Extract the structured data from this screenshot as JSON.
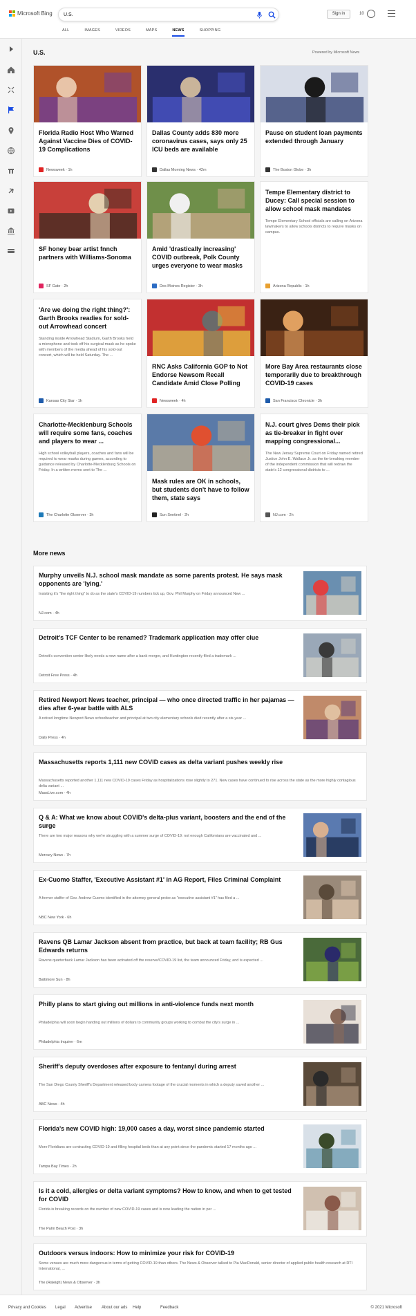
{
  "header": {
    "logo_text": "Microsoft Bing",
    "search_value": "U.S.",
    "nav": [
      "ALL",
      "IMAGES",
      "VIDEOS",
      "MAPS",
      "NEWS",
      "SHOPPING"
    ],
    "active_nav": "NEWS",
    "signin": "Sign in",
    "rewards_count": "10",
    "accent": "#174ae4"
  },
  "section": {
    "title": "U.S.",
    "powered_by": "Powered by Microsoft News",
    "more_title": "More news"
  },
  "cards": [
    {
      "title": "Florida Radio Host Who Warned Against Vaccine Dies of COVID-19 Complications",
      "desc": "",
      "source": "Newsweek",
      "time": "1h",
      "icon": "#e02424"
    },
    {
      "title": "Dallas County adds 830 more coronavirus cases, says only 25 ICU beds are available",
      "desc": "",
      "source": "Dallas Morning News",
      "time": "42m",
      "icon": "#333333"
    },
    {
      "title": "Pause on student loan payments extended through January",
      "desc": "",
      "source": "The Boston Globe",
      "time": "3h",
      "icon": "#333333"
    },
    {
      "title": "SF honey bear artist fnnch partners with Williams-Sonoma",
      "desc": "",
      "source": "SF Gate",
      "time": "2h",
      "icon": "#e0245e"
    },
    {
      "title": "Amid 'drastically increasing' COVID outbreak, Polk County urges everyone to wear masks",
      "desc": "",
      "source": "Des Moines Register",
      "time": "3h",
      "icon": "#2b6cc4"
    },
    {
      "title": "Tempe Elementary district to Ducey: Call special session to allow school mask mandates",
      "desc": "Tempe Elementary School officials are calling on Arizona lawmakers to allow schools districts to require masks on campus.",
      "source": "Arizona Republic",
      "time": "1h",
      "icon": "#e8a030"
    },
    {
      "title": "'Are we doing the right thing?': Garth Brooks readies for sold-out Arrowhead concert",
      "desc": "Standing inside Arrowhead Stadium, Garth Brooks held a microphone and took off his surgical mask as he spoke with members of the media ahead of his sold-out concert, which will be held Saturday. The ...",
      "source": "Kansas City Star",
      "time": "1h",
      "icon": "#1e5bab"
    },
    {
      "title": "RNC Asks California GOP to Not Endorse Newsom Recall Candidate Amid Close Polling",
      "desc": "",
      "source": "Newsweek",
      "time": "4h",
      "icon": "#e02424"
    },
    {
      "title": "More Bay Area restaurants close temporarily due to breakthrough COVID-19 cases",
      "desc": "",
      "source": "San Francisco Chronicle",
      "time": "3h",
      "icon": "#1e5bab"
    },
    {
      "title": "Charlotte-Mecklenburg Schools will require some fans, coaches and players to wear ...",
      "desc": "High school volleyball players, coaches and fans will be required to wear masks during games, according to guidance released by Charlotte-Mecklenburg Schools on Friday. In a written memo sent to The ...",
      "source": "The Charlotte Observer",
      "time": "3h",
      "icon": "#1e7ab8"
    },
    {
      "title": "Mask rules are OK in schools, but students don't have to follow them, state says",
      "desc": "",
      "source": "Sun Sentinel",
      "time": "2h",
      "icon": "#222222"
    },
    {
      "title": "N.J. court gives Dems their pick as tie-breaker in fight over mapping congressional...",
      "desc": "The New Jersey Supreme Court on Friday named retired Justice John E. Wallace Jr. as the tie-breaking member of the independent commission that will redraw the state's 12 congressional districts to ...",
      "source": "NJ.com",
      "time": "2h",
      "icon": "#555555"
    }
  ],
  "more": [
    {
      "title": "Murphy unveils N.J. school mask mandate as some parents protest. He says mask opponents are 'lying.'",
      "desc": "Insisting it's \"the right thing\" to do as the state's COVID-19 numbers tick up, Gov. Phil Murphy on Friday announced New ...",
      "source": "NJ.com",
      "time": "4h",
      "icon": "#555555"
    },
    {
      "title": "Detroit's TCF Center to be renamed? Trademark application may offer clue",
      "desc": "Detroit's convention center likely needs a new name after a bank merger, and Huntington recently filed a trademark ...",
      "source": "Detroit Free Press",
      "time": "4h",
      "icon": "#1e5bab"
    },
    {
      "title": "Retired Newport News teacher, principal — who once directed traffic in her pajamas — dies after 6-year battle with ALS",
      "desc": "A retired longtime Newport News schoolteacher and principal at two city elementary schools died recently after a six-year ...",
      "source": "Daily Press",
      "time": "4h",
      "icon": "#333333"
    },
    {
      "title": "Massachusetts reports 1,111 new COVID cases as delta variant pushes weekly rise",
      "desc": "Massachusetts reported another 1,111 new COVID-19 cases Friday as hospitalizations rose slightly to 271. New cases have continued to rise across the state as the more highly contagious delta variant ...",
      "source": "MassLive.com",
      "time": "4h",
      "icon": "#e02424"
    },
    {
      "title": "Q & A: What we know about COVID's delta-plus variant, boosters and the end of the surge",
      "desc": "There are two major reasons why we're struggling with a summer surge of COVID-19: not enough Californians are vaccinated and ...",
      "source": "Mercury News",
      "time": "7h",
      "icon": "#1e5bab"
    },
    {
      "title": "Ex-Cuomo Staffer, 'Executive Assistant #1' in AG Report, Files Criminal Complaint",
      "desc": "A former staffer of Gov. Andrew Cuomo identified in the attorney general probe as \"executive assistant #1\" has filed a ...",
      "source": "NBC New York",
      "time": "6h",
      "icon": "#1e3a8a"
    },
    {
      "title": "Ravens QB Lamar Jackson absent from practice, but back at team facility; RB Gus Edwards returns",
      "desc": "Ravens quarterback Lamar Jackson has been activated off the reserve/COVID-19 list, the team announced Friday, and is expected ...",
      "source": "Baltimore Sun",
      "time": "8h",
      "icon": "#e8a030"
    },
    {
      "title": "Philly plans to start giving out millions in anti-violence funds next month",
      "desc": "Philadelphia will soon begin handing out millions of dollars to community groups working to combat the city's surge in ...",
      "source": "Philadelphia Inquirer",
      "time": "6m",
      "icon": "#333333"
    },
    {
      "title": "Sheriff's deputy overdoses after exposure to fentanyl during arrest",
      "desc": "The San Diego County Sheriff's Department released body camera footage of the crucial moments in which a deputy saved another ...",
      "source": "ABC News",
      "time": "4h",
      "icon": "#333333"
    },
    {
      "title": "Florida's new COVID high: 19,000 cases a day, worst since pandemic started",
      "desc": "More Floridians are contracting COVID-19 and filling hospital beds than at any point since the pandemic started 17 months ago ...",
      "source": "Tampa Bay Times",
      "time": "2h",
      "icon": "#2e9e6a"
    },
    {
      "title": "Is it a cold, allergies or delta variant symptoms? How to know, and when to get tested for COVID",
      "desc": "Florida is breaking records on the number of new COVID-19 cases and is now leading the nation in per ...",
      "source": "The Palm Beach Post",
      "time": "3h",
      "icon": "#1e5bab"
    },
    {
      "title": "Outdoors versus indoors: How to minimize your risk for COVID-19",
      "desc": "Some venues are much more dangerous in terms of getting COVID-19 than others. The News & Observer talked to Pia MacDonald, senior director of applied public health research at RTI International, ...",
      "source": "The (Raleigh) News & Observer",
      "time": "3h",
      "icon": "#c02020"
    }
  ],
  "footer": {
    "links": [
      "Privacy and Cookies",
      "Legal",
      "Advertise",
      "About our ads",
      "Help",
      "Feedback"
    ],
    "copyright": "© 2021 Microsoft"
  }
}
